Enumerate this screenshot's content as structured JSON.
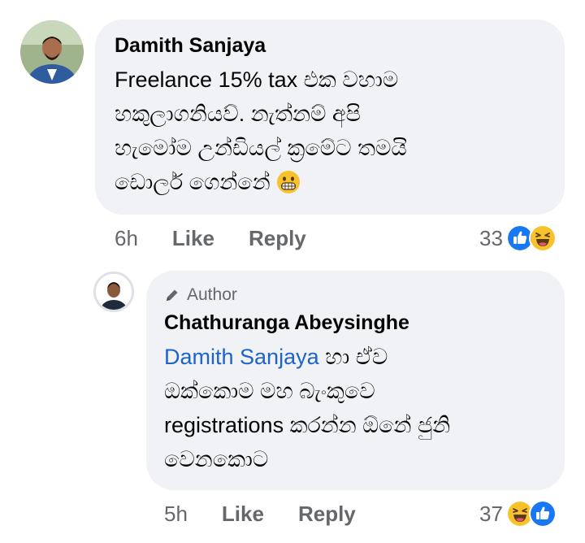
{
  "comments": [
    {
      "author": "Damith Sanjaya",
      "text": "Freelance 15% tax එක වහාම හකුලාගනියව්. නැත්නම් අපි හැමෝම උන්ඩියල් ක්‍රමේට තමයි ඩොලර් ගෙන්නේ",
      "lines": [
        "Freelance 15% tax එක වහාම",
        "හකුලාගනියව්. නැත්නම් අපි",
        "හැමෝම උන්ඩියල් ක්‍රමේට තමයි",
        "ඩොලර් ගෙන්නේ"
      ],
      "emoji": "grimacing-face",
      "time": "6h",
      "like_label": "Like",
      "reply_label": "Reply",
      "reaction_count": "33",
      "reactions": [
        "like",
        "haha"
      ]
    }
  ],
  "reply": {
    "badge": "Author",
    "author": "Chathuranga Abeysinghe",
    "mention": "Damith Sanjaya",
    "lines": [
      " හා ඒව",
      "ඔක්කොම මහ බැංකුවෙ",
      "registrations කරන්න ඕනේ ජුනි",
      "වෙනකොට"
    ],
    "time": "5h",
    "like_label": "Like",
    "reply_label": "Reply",
    "reaction_count": "37",
    "reactions": [
      "haha",
      "like"
    ]
  },
  "colors": {
    "bubble": "#f0f2f5",
    "like_blue": "#1877f2",
    "haha_yellow": "#f7c22b",
    "mention": "#1d63c9",
    "muted": "#65676b"
  }
}
